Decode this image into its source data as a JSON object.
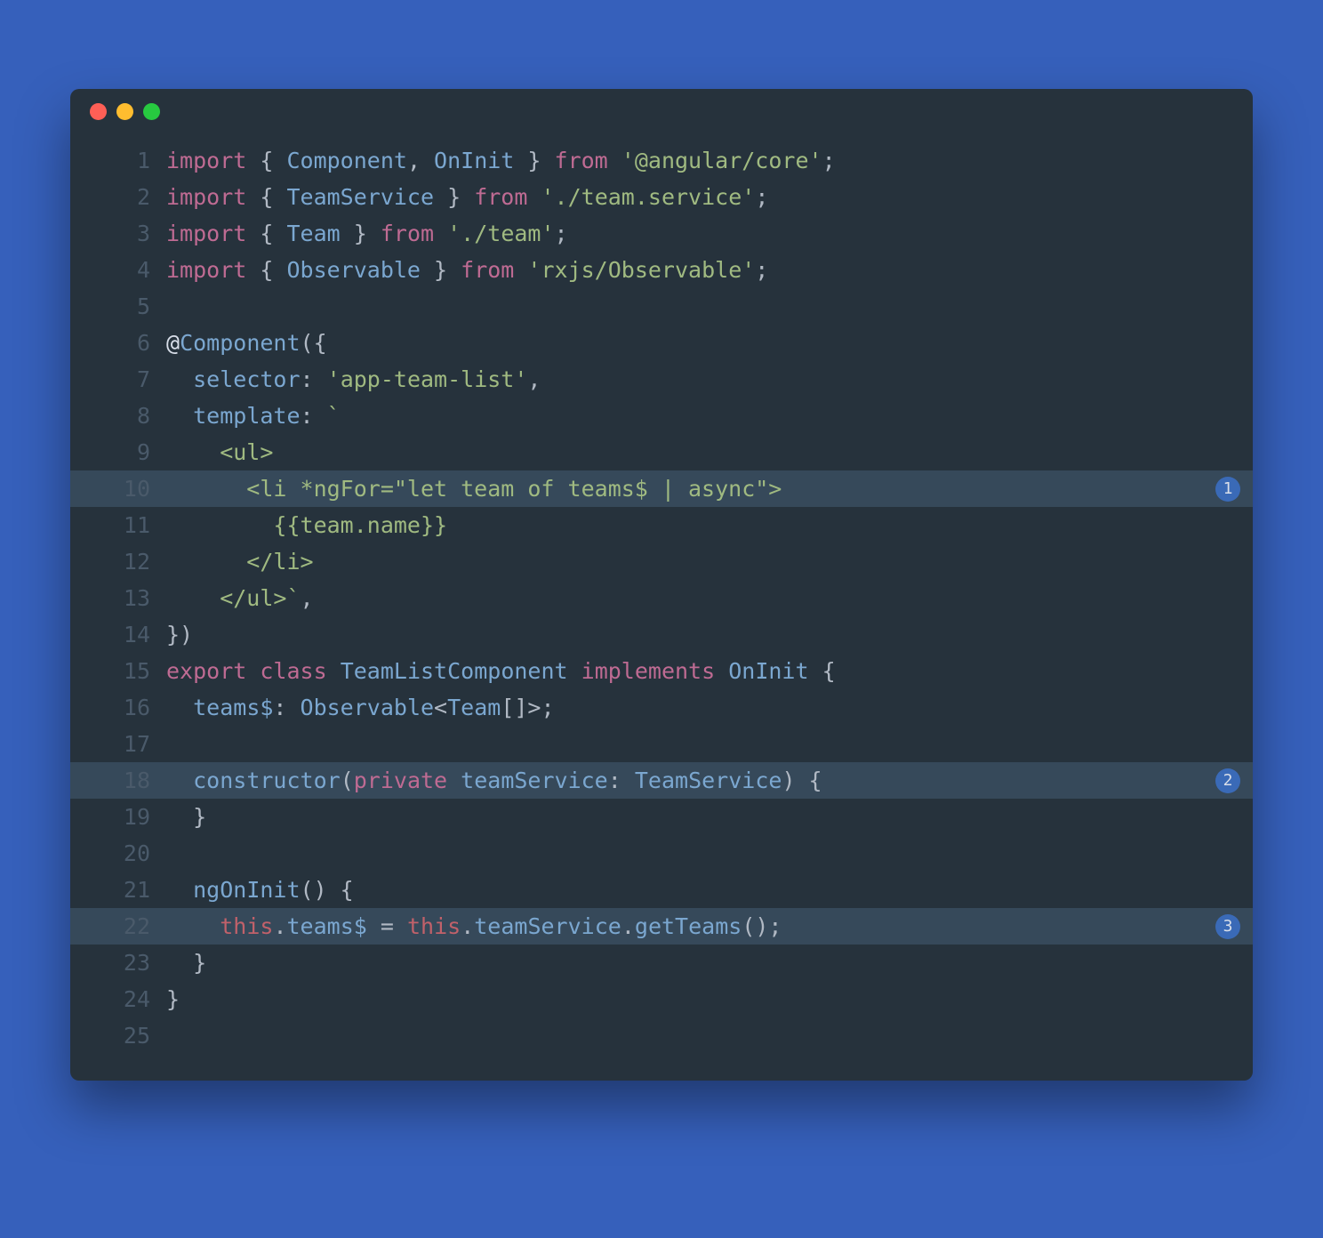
{
  "window": {
    "traffic_lights": [
      "close",
      "minimize",
      "maximize"
    ]
  },
  "code": {
    "highlighted_lines": [
      10,
      18,
      22
    ],
    "callouts": {
      "10": "1",
      "18": "2",
      "22": "3"
    },
    "lines": [
      {
        "n": 1,
        "tokens": [
          [
            "kw",
            "import"
          ],
          [
            "punc",
            " { "
          ],
          [
            "id",
            "Component"
          ],
          [
            "punc",
            ", "
          ],
          [
            "id",
            "OnInit"
          ],
          [
            "punc",
            " } "
          ],
          [
            "kw",
            "from"
          ],
          [
            "punc",
            " "
          ],
          [
            "str",
            "'@angular/core'"
          ],
          [
            "punc",
            ";"
          ]
        ]
      },
      {
        "n": 2,
        "tokens": [
          [
            "kw",
            "import"
          ],
          [
            "punc",
            " { "
          ],
          [
            "id",
            "TeamService"
          ],
          [
            "punc",
            " } "
          ],
          [
            "kw",
            "from"
          ],
          [
            "punc",
            " "
          ],
          [
            "str",
            "'./team.service'"
          ],
          [
            "punc",
            ";"
          ]
        ]
      },
      {
        "n": 3,
        "tokens": [
          [
            "kw",
            "import"
          ],
          [
            "punc",
            " { "
          ],
          [
            "id",
            "Team"
          ],
          [
            "punc",
            " } "
          ],
          [
            "kw",
            "from"
          ],
          [
            "punc",
            " "
          ],
          [
            "str",
            "'./team'"
          ],
          [
            "punc",
            ";"
          ]
        ]
      },
      {
        "n": 4,
        "tokens": [
          [
            "kw",
            "import"
          ],
          [
            "punc",
            " { "
          ],
          [
            "id",
            "Observable"
          ],
          [
            "punc",
            " } "
          ],
          [
            "kw",
            "from"
          ],
          [
            "punc",
            " "
          ],
          [
            "str",
            "'rxjs/Observable'"
          ],
          [
            "punc",
            ";"
          ]
        ]
      },
      {
        "n": 5,
        "tokens": []
      },
      {
        "n": 6,
        "tokens": [
          [
            "ann",
            "@"
          ],
          [
            "fn",
            "Component"
          ],
          [
            "punc",
            "({"
          ]
        ]
      },
      {
        "n": 7,
        "tokens": [
          [
            "punc",
            "  "
          ],
          [
            "id",
            "selector"
          ],
          [
            "punc",
            ": "
          ],
          [
            "str",
            "'app-team-list'"
          ],
          [
            "punc",
            ","
          ]
        ]
      },
      {
        "n": 8,
        "tokens": [
          [
            "punc",
            "  "
          ],
          [
            "id",
            "template"
          ],
          [
            "punc",
            ": "
          ],
          [
            "tmpl",
            "`"
          ]
        ]
      },
      {
        "n": 9,
        "tokens": [
          [
            "tmpl",
            "    <ul>"
          ]
        ]
      },
      {
        "n": 10,
        "tokens": [
          [
            "tmpl",
            "      <li *ngFor=\"let team of teams$ | async\">"
          ]
        ]
      },
      {
        "n": 11,
        "tokens": [
          [
            "tmpl",
            "        {{team.name}}"
          ]
        ]
      },
      {
        "n": 12,
        "tokens": [
          [
            "tmpl",
            "      </li>"
          ]
        ]
      },
      {
        "n": 13,
        "tokens": [
          [
            "tmpl",
            "    </ul>`"
          ],
          [
            "punc",
            ","
          ]
        ]
      },
      {
        "n": 14,
        "tokens": [
          [
            "punc",
            "})"
          ]
        ]
      },
      {
        "n": 15,
        "tokens": [
          [
            "kw",
            "export"
          ],
          [
            "punc",
            " "
          ],
          [
            "kw",
            "class"
          ],
          [
            "punc",
            " "
          ],
          [
            "id",
            "TeamListComponent"
          ],
          [
            "punc",
            " "
          ],
          [
            "kw",
            "implements"
          ],
          [
            "punc",
            " "
          ],
          [
            "id",
            "OnInit"
          ],
          [
            "punc",
            " {"
          ]
        ]
      },
      {
        "n": 16,
        "tokens": [
          [
            "punc",
            "  "
          ],
          [
            "id",
            "teams$"
          ],
          [
            "punc",
            ": "
          ],
          [
            "id",
            "Observable"
          ],
          [
            "punc",
            "<"
          ],
          [
            "id",
            "Team"
          ],
          [
            "punc",
            "[]>;"
          ]
        ]
      },
      {
        "n": 17,
        "tokens": []
      },
      {
        "n": 18,
        "tokens": [
          [
            "punc",
            "  "
          ],
          [
            "fn",
            "constructor"
          ],
          [
            "punc",
            "("
          ],
          [
            "kw",
            "private"
          ],
          [
            "punc",
            " "
          ],
          [
            "id",
            "teamService"
          ],
          [
            "punc",
            ": "
          ],
          [
            "id",
            "TeamService"
          ],
          [
            "punc",
            ") {"
          ]
        ]
      },
      {
        "n": 19,
        "tokens": [
          [
            "punc",
            "  }"
          ]
        ]
      },
      {
        "n": 20,
        "tokens": []
      },
      {
        "n": 21,
        "tokens": [
          [
            "punc",
            "  "
          ],
          [
            "fn",
            "ngOnInit"
          ],
          [
            "punc",
            "() {"
          ]
        ]
      },
      {
        "n": 22,
        "tokens": [
          [
            "punc",
            "    "
          ],
          [
            "this",
            "this"
          ],
          [
            "punc",
            "."
          ],
          [
            "id",
            "teams$"
          ],
          [
            "punc",
            " = "
          ],
          [
            "this",
            "this"
          ],
          [
            "punc",
            "."
          ],
          [
            "id",
            "teamService"
          ],
          [
            "punc",
            "."
          ],
          [
            "fn",
            "getTeams"
          ],
          [
            "punc",
            "();"
          ]
        ]
      },
      {
        "n": 23,
        "tokens": [
          [
            "punc",
            "  }"
          ]
        ]
      },
      {
        "n": 24,
        "tokens": [
          [
            "punc",
            "}"
          ]
        ]
      },
      {
        "n": 25,
        "tokens": []
      }
    ]
  }
}
